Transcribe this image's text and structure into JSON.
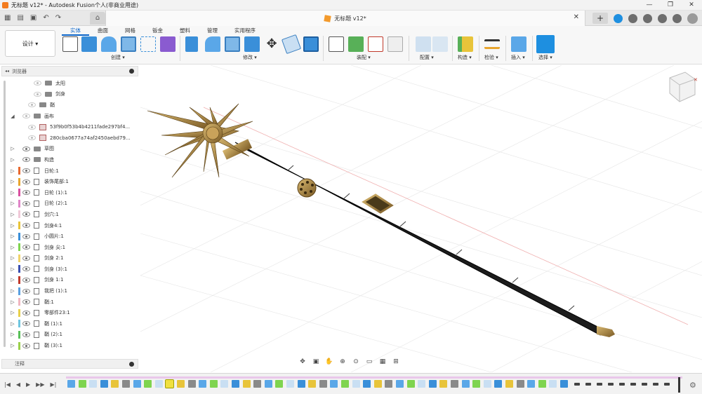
{
  "window": {
    "title": "无标题 v12* - Autodesk Fusion个人(非商业用途)",
    "buttons": [
      "—",
      "❐",
      "✕"
    ]
  },
  "document_tab": {
    "title": "无标题 v12*",
    "close": "✕"
  },
  "workspace": {
    "label": "设计 ▾"
  },
  "ribbon": {
    "tabs": [
      "实体",
      "曲面",
      "网格",
      "钣金",
      "塑料",
      "管理",
      "实用程序"
    ],
    "active_tab": "实体",
    "groups": [
      "创建 ▾",
      "修改 ▾",
      "装配 ▾",
      "配置 ▾",
      "构造 ▾",
      "检验 ▾",
      "插入 ▾",
      "选择 ▾"
    ]
  },
  "browser": {
    "title": "浏览器",
    "toggle": "◂◂",
    "items": [
      {
        "label": "太阳",
        "indent": 3,
        "icon": "folder",
        "arrow": "",
        "visible": false
      },
      {
        "label": "剑身",
        "indent": 3,
        "icon": "folder",
        "arrow": "",
        "visible": false
      },
      {
        "label": "鞘",
        "indent": 2,
        "icon": "folder",
        "arrow": "",
        "visible": false
      },
      {
        "label": "画布",
        "indent": 1,
        "icon": "folder",
        "arrow": "◢",
        "visible": false
      },
      {
        "label": "53f9b0f53b4b4211fade297bf4...",
        "indent": 2,
        "icon": "canvas",
        "arrow": "",
        "visible": false
      },
      {
        "label": "280cba0677a74af2450aebd79...",
        "indent": 2,
        "icon": "canvas",
        "arrow": "",
        "visible": false
      },
      {
        "label": "草图",
        "indent": 1,
        "icon": "folder",
        "arrow": "▷",
        "visible": true
      },
      {
        "label": "构造",
        "indent": 1,
        "icon": "folder",
        "arrow": "▷",
        "visible": true
      },
      {
        "label": "日轮:1",
        "indent": 1,
        "icon": "comp",
        "arrow": "▷",
        "visible": true,
        "color": "#e8682e"
      },
      {
        "label": "装饰尾部:1",
        "indent": 1,
        "icon": "comp",
        "arrow": "▷",
        "visible": true,
        "color": "#e8a52e"
      },
      {
        "label": "日轮 (1):1",
        "indent": 1,
        "icon": "comp",
        "arrow": "▷",
        "visible": true,
        "color": "#d94fa0"
      },
      {
        "label": "日轮 (2):1",
        "indent": 1,
        "icon": "comp",
        "arrow": "▷",
        "visible": true,
        "color": "#e085c8"
      },
      {
        "label": "剑穴:1",
        "indent": 1,
        "icon": "comp",
        "arrow": "▷",
        "visible": true,
        "color": "#f0c9d8"
      },
      {
        "label": "剑身4:1",
        "indent": 1,
        "icon": "comp",
        "arrow": "▷",
        "visible": true,
        "color": "#e8c43a"
      },
      {
        "label": "小圆片:1",
        "indent": 1,
        "icon": "comp",
        "arrow": "▷",
        "visible": true,
        "color": "#3a8fd9"
      },
      {
        "label": "剑身 尖:1",
        "indent": 1,
        "icon": "comp",
        "arrow": "▷",
        "visible": true,
        "color": "#7fd44f"
      },
      {
        "label": "剑身 2:1",
        "indent": 1,
        "icon": "comp",
        "arrow": "▷",
        "visible": true,
        "color": "#f0d36a"
      },
      {
        "label": "剑身 (3):1",
        "indent": 1,
        "icon": "comp",
        "arrow": "▷",
        "visible": true,
        "color": "#3a4fb0"
      },
      {
        "label": "剑身 1:1",
        "indent": 1,
        "icon": "comp",
        "arrow": "▷",
        "visible": true,
        "color": "#c0392b"
      },
      {
        "label": "我把 (1):1",
        "indent": 1,
        "icon": "comp",
        "arrow": "▷",
        "visible": true,
        "color": "#5aa0e0"
      },
      {
        "label": "鞘:1",
        "indent": 1,
        "icon": "comp",
        "arrow": "▷",
        "visible": true,
        "color": "#f0b6c0"
      },
      {
        "label": "零部件23:1",
        "indent": 1,
        "icon": "comp",
        "arrow": "▷",
        "visible": true,
        "color": "#e8d04a"
      },
      {
        "label": "鞘 (1):1",
        "indent": 1,
        "icon": "comp",
        "arrow": "▷",
        "visible": true,
        "color": "#6fc6e0"
      },
      {
        "label": "鞘 (2):1",
        "indent": 1,
        "icon": "comp",
        "arrow": "▷",
        "visible": true,
        "color": "#58c058"
      },
      {
        "label": "鞘 (3):1",
        "indent": 1,
        "icon": "comp",
        "arrow": "▷",
        "visible": true,
        "color": "#9ad04a"
      }
    ]
  },
  "comments": {
    "title": "注释"
  },
  "timeline": {
    "play_controls": [
      "|◀",
      "◀",
      "▶",
      "▶▶",
      "▶|"
    ]
  },
  "colors": {
    "accent": "#0a64c8",
    "sword_body": "#1c1c1c",
    "gold": "#b08a45"
  }
}
